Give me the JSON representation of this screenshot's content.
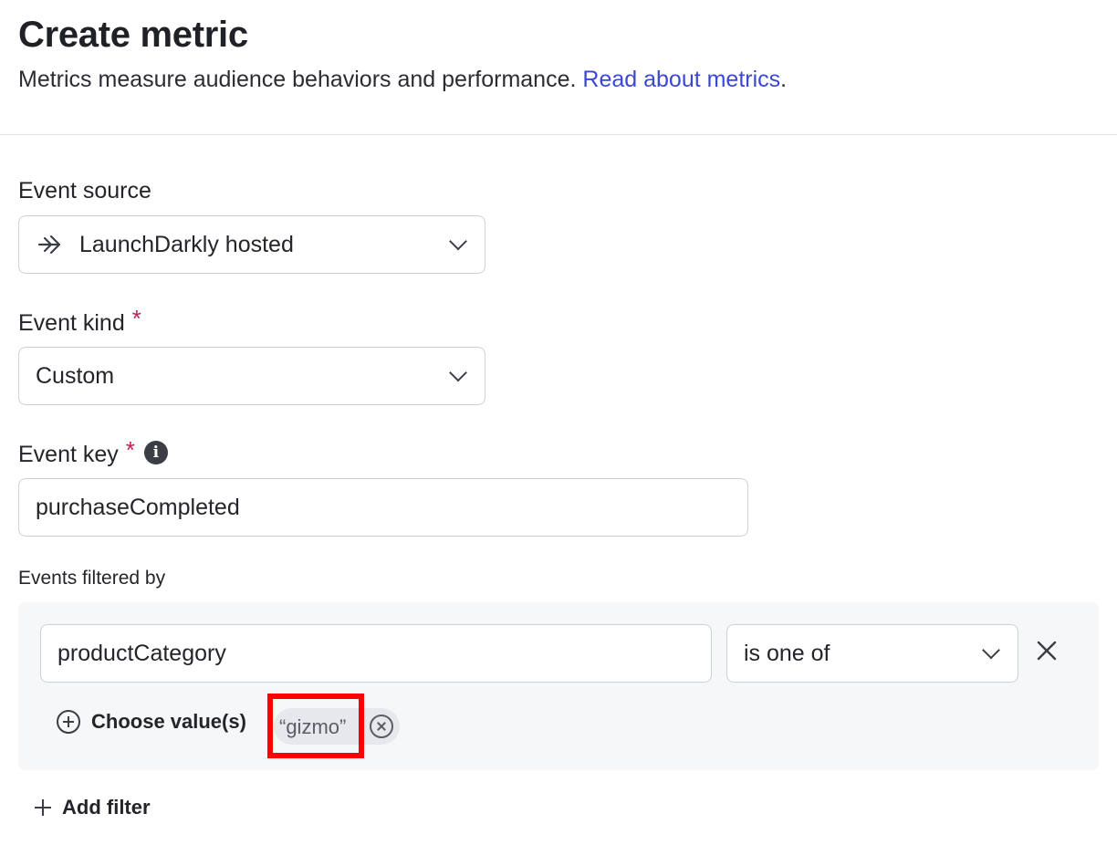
{
  "header": {
    "title": "Create metric",
    "subtitle": "Metrics measure audience behaviors and performance.",
    "link_text": "Read about metrics",
    "link_suffix": "."
  },
  "event_source": {
    "label": "Event source",
    "value": "LaunchDarkly hosted",
    "icon": "launchdarkly-arrow-icon"
  },
  "event_kind": {
    "label": "Event kind",
    "required_mark": "*",
    "value": "Custom"
  },
  "event_key": {
    "label": "Event key",
    "required_mark": "*",
    "info_icon": "info-icon",
    "value": "purchaseCompleted"
  },
  "filters": {
    "section_label": "Events filtered by",
    "items": [
      {
        "attribute": "productCategory",
        "operator": "is one of",
        "choose_label": "Choose value(s)",
        "values": [
          "“gizmo”"
        ]
      }
    ],
    "add_filter_label": "Add filter"
  },
  "colors": {
    "link": "#3a48d4",
    "required": "#c21d4f",
    "highlight": "#ff0000",
    "filter_bg": "#f6f7f9"
  }
}
